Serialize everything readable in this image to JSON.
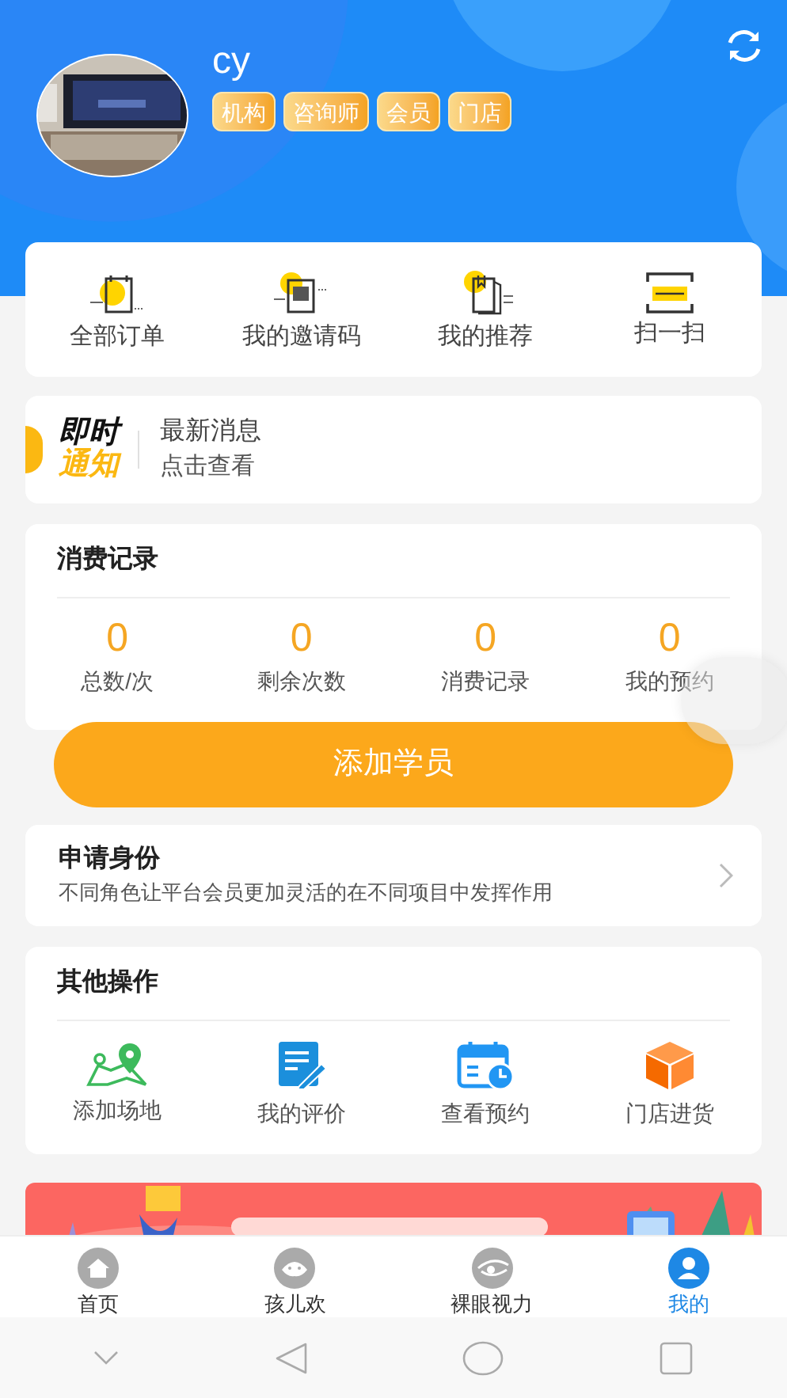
{
  "header": {
    "username": "cy",
    "tags": [
      "机构",
      "咨询师",
      "会员",
      "门店"
    ]
  },
  "quick_actions": [
    {
      "label": "全部订单",
      "kind": "orders"
    },
    {
      "label": "我的邀请码",
      "kind": "invite"
    },
    {
      "label": "我的推荐",
      "kind": "recommend"
    },
    {
      "label": "扫一扫",
      "kind": "scan"
    }
  ],
  "notice": {
    "logo_top": "即时",
    "logo_bottom": "通知",
    "title": "最新消息",
    "subtitle": "点击查看"
  },
  "consumption": {
    "title": "消费记录",
    "stats": [
      {
        "value": "0",
        "label": "总数/次"
      },
      {
        "value": "0",
        "label": "剩余次数"
      },
      {
        "value": "0",
        "label": "消费记录"
      },
      {
        "value": "0",
        "label": "我的预约"
      }
    ]
  },
  "add_button": "添加学员",
  "identity": {
    "title": "申请身份",
    "description": "不同角色让平台会员更加灵活的在不同项目中发挥作用"
  },
  "other_ops": {
    "title": "其他操作",
    "items": [
      {
        "label": "添加场地",
        "kind": "map"
      },
      {
        "label": "我的评价",
        "kind": "review"
      },
      {
        "label": "查看预约",
        "kind": "calendar"
      },
      {
        "label": "门店进货",
        "kind": "box"
      }
    ]
  },
  "tab_bar": [
    {
      "label": "首页",
      "kind": "home",
      "selected": false
    },
    {
      "label": "孩儿欢",
      "kind": "kid",
      "selected": false
    },
    {
      "label": "裸眼视力",
      "kind": "eye",
      "selected": false
    },
    {
      "label": "我的",
      "kind": "me",
      "selected": true
    }
  ]
}
